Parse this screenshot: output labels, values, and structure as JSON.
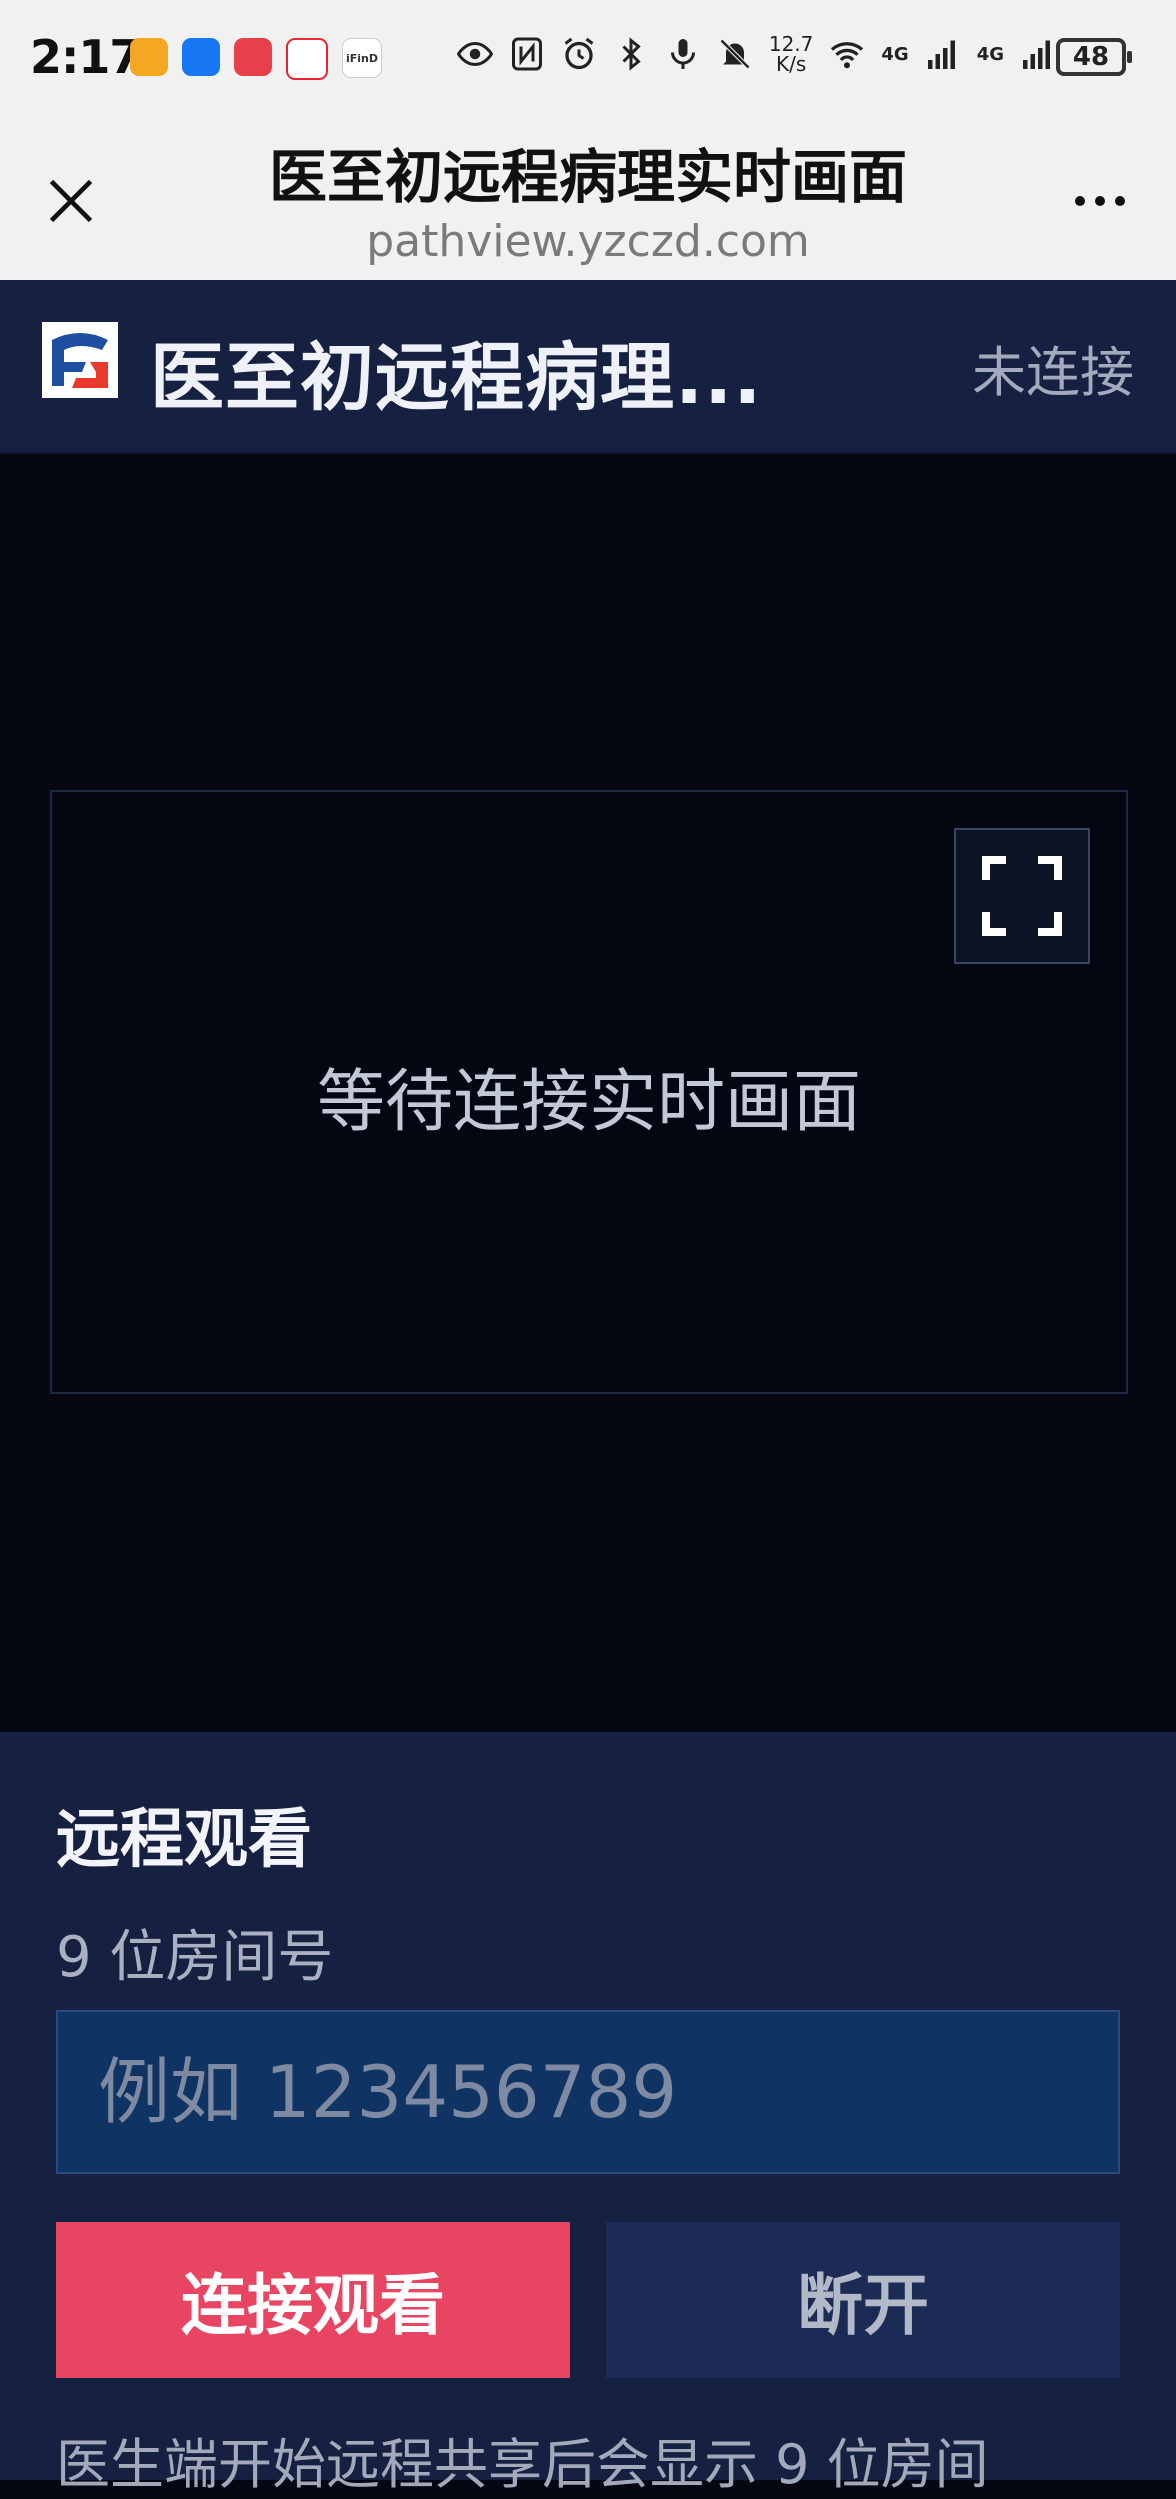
{
  "status_bar": {
    "time": "2:17",
    "app_icons": [
      "orange-app-icon",
      "blue-app-icon",
      "huawei-store-icon",
      "game-app-icon",
      "ifind-app-icon"
    ],
    "ifind_label": "iFinD",
    "net_speed_value": "12.7",
    "net_speed_unit": "K/s",
    "signal_1": "4G",
    "signal_2": "4G",
    "battery": "48"
  },
  "browser": {
    "title": "医至初远程病理实时画面",
    "url": "pathview.yzczd.com"
  },
  "app_header": {
    "title": "医至初远程病理...",
    "connection_status": "未连接"
  },
  "viewer": {
    "placeholder_text": "等待连接实时画面"
  },
  "panel": {
    "title": "远程观看",
    "room_label": "9 位房间号",
    "room_input_value": "",
    "room_input_placeholder": "例如 123456789",
    "connect_label": "连接观看",
    "disconnect_label": "断开",
    "hint": "医生端开始远程共享后会显示 9 位房间"
  },
  "colors": {
    "primary_button": "#e84562",
    "panel_bg": "#162040",
    "viewer_bg": "#050812",
    "input_bg": "#0f3363"
  }
}
